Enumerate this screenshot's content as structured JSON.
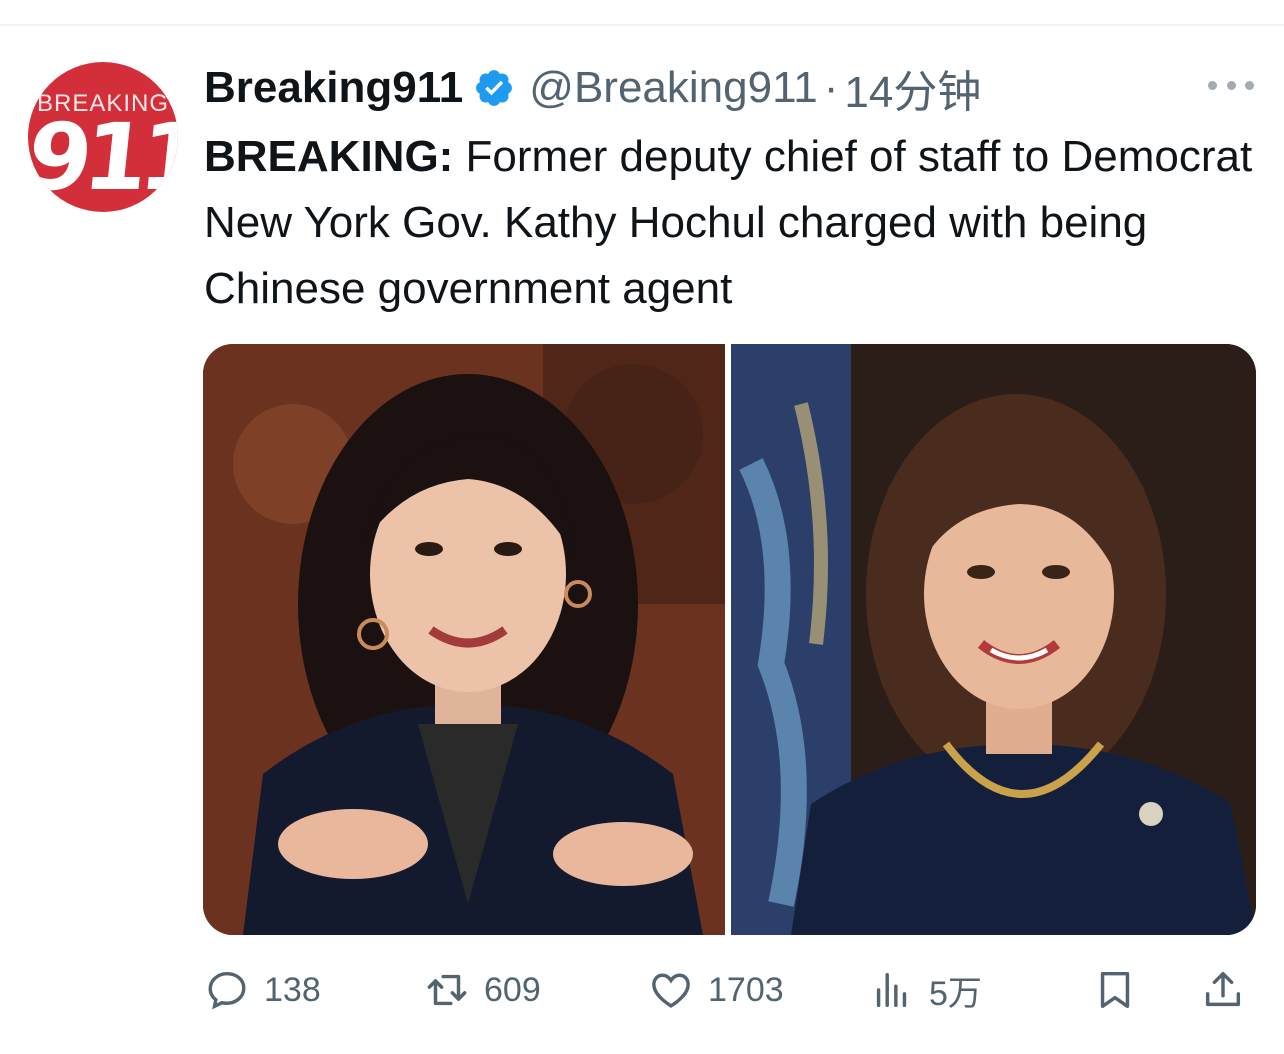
{
  "tweet": {
    "avatar": {
      "top_text": "BREAKING",
      "number_text": "911",
      "bg_color": "#d32f3a"
    },
    "author_name": "Breaking911",
    "verified": true,
    "handle": "@Breaking911",
    "separator": "·",
    "time": "14分钟",
    "text_bold": "BREAKING:",
    "text_body": " Former deputy chief of staff to Democrat New York Gov. Kathy Hochul charged with being Chinese government agent",
    "media": [
      {
        "icon": "photo-woman-earrings"
      },
      {
        "icon": "photo-woman-necklace"
      }
    ],
    "actions": {
      "replies": "138",
      "retweets": "609",
      "likes": "1703",
      "views": "5万"
    },
    "colors": {
      "muted": "#536471",
      "verified": "#1d9bf0"
    }
  }
}
